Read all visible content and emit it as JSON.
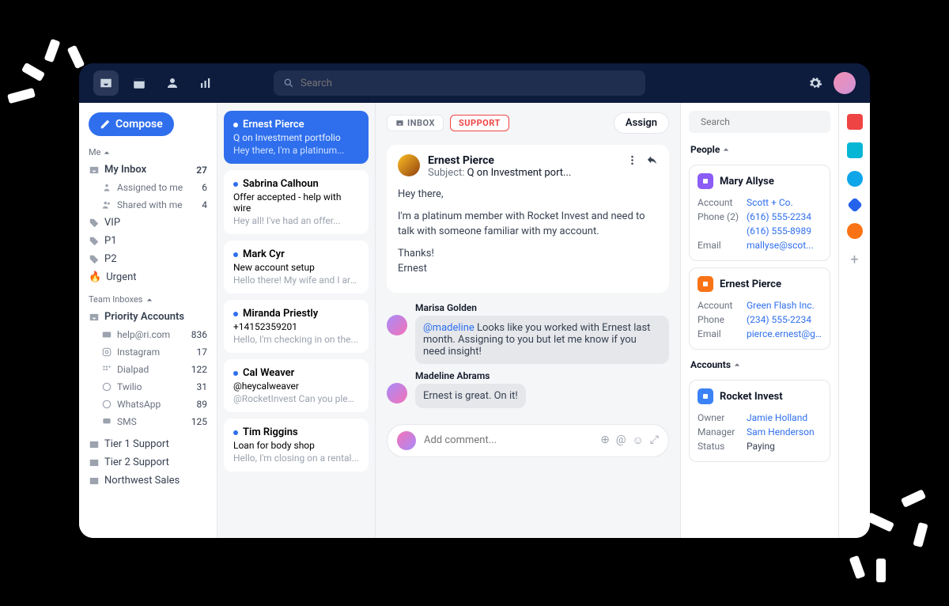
{
  "topbar": {
    "search_placeholder": "Search"
  },
  "sidebar": {
    "compose_label": "Compose",
    "me_label": "Me",
    "my_inbox": {
      "label": "My Inbox",
      "count": 27
    },
    "assigned": {
      "label": "Assigned to me",
      "count": 6
    },
    "shared": {
      "label": "Shared with me",
      "count": 4
    },
    "tags": [
      {
        "label": "VIP",
        "color": "pink"
      },
      {
        "label": "P1",
        "color": "blue"
      },
      {
        "label": "P2",
        "color": "blue"
      }
    ],
    "urgent_label": "Urgent",
    "team_label": "Team Inboxes",
    "priority_label": "Priority Accounts",
    "team_items": [
      {
        "label": "help@ri.com",
        "count": 836
      },
      {
        "label": "Instagram",
        "count": 17
      },
      {
        "label": "Dialpad",
        "count": 122
      },
      {
        "label": "Twilio",
        "count": 31
      },
      {
        "label": "WhatsApp",
        "count": 89
      },
      {
        "label": "SMS",
        "count": 125
      }
    ],
    "tier1_label": "Tier 1 Support",
    "tier2_label": "Tier 2 Support",
    "northwest_label": "Northwest Sales"
  },
  "threads": [
    {
      "from": "Ernest Pierce",
      "subject": "Q on Investment portfolio",
      "preview": "Hey there, I'm a platinum...",
      "active": true
    },
    {
      "from": "Sabrina Calhoun",
      "subject": "Offer accepted - help with wire",
      "preview": "Hey all! I've had an offer..."
    },
    {
      "from": "Mark Cyr",
      "subject": "New account setup",
      "preview": "Hello there! My wife and I are..."
    },
    {
      "from": "Miranda Priestly",
      "subject": "+14152359201",
      "preview": "Hello, I'm checking in on the..."
    },
    {
      "from": "Cal Weaver",
      "subject": "@heycalweaver",
      "preview": "@RocketInvest Can you pleas..."
    },
    {
      "from": "Tim Riggins",
      "subject": "Loan for body shop",
      "preview": "Hello, I'm closing on a rental..."
    }
  ],
  "convo": {
    "inbox_pill": "INBOX",
    "support_pill": "SUPPORT",
    "assign_label": "Assign",
    "message": {
      "from": "Ernest Pierce",
      "subject_label": "Subject:",
      "subject": "Q on Investment port...",
      "body_p1": "Hey there,",
      "body_p2": "I'm a platinum member with Rocket Invest and need to talk with someone familiar with my account.",
      "body_p3": "Thanks!",
      "body_p4": "Ernest"
    },
    "comments": [
      {
        "author": "Marisa Golden",
        "mention": "@madeline",
        "text": " Looks like you worked with Ernest last month. Assigning to you but let me know if you need insight!"
      },
      {
        "author": "Madeline Abrams",
        "text": "Ernest is great. On it!"
      }
    ],
    "composer_placeholder": "Add comment..."
  },
  "rpanel": {
    "search_placeholder": "Search",
    "people_label": "People",
    "accounts_label": "Accounts",
    "people": [
      {
        "name": "Mary Allyse",
        "icon": "purple",
        "rows": [
          {
            "k": "Account",
            "v": "Scott + Co."
          },
          {
            "k": "Phone (2)",
            "v": "(616) 555-2234"
          },
          {
            "k": "",
            "v": "(616) 555-8989"
          },
          {
            "k": "Email",
            "v": "mallyse@scot..."
          }
        ]
      },
      {
        "name": "Ernest Pierce",
        "icon": "orange",
        "rows": [
          {
            "k": "Account",
            "v": "Green Flash Inc."
          },
          {
            "k": "Phone",
            "v": "(234) 555-2234"
          },
          {
            "k": "Email",
            "v": "pierce.ernest@gr..."
          }
        ]
      }
    ],
    "accounts": [
      {
        "name": "Rocket Invest",
        "icon": "blue",
        "rows": [
          {
            "k": "Owner",
            "v": "Jamie Holland"
          },
          {
            "k": "Manager",
            "v": "Sam Henderson"
          },
          {
            "k": "Status",
            "v": "Paying",
            "plain": true
          }
        ]
      }
    ]
  }
}
